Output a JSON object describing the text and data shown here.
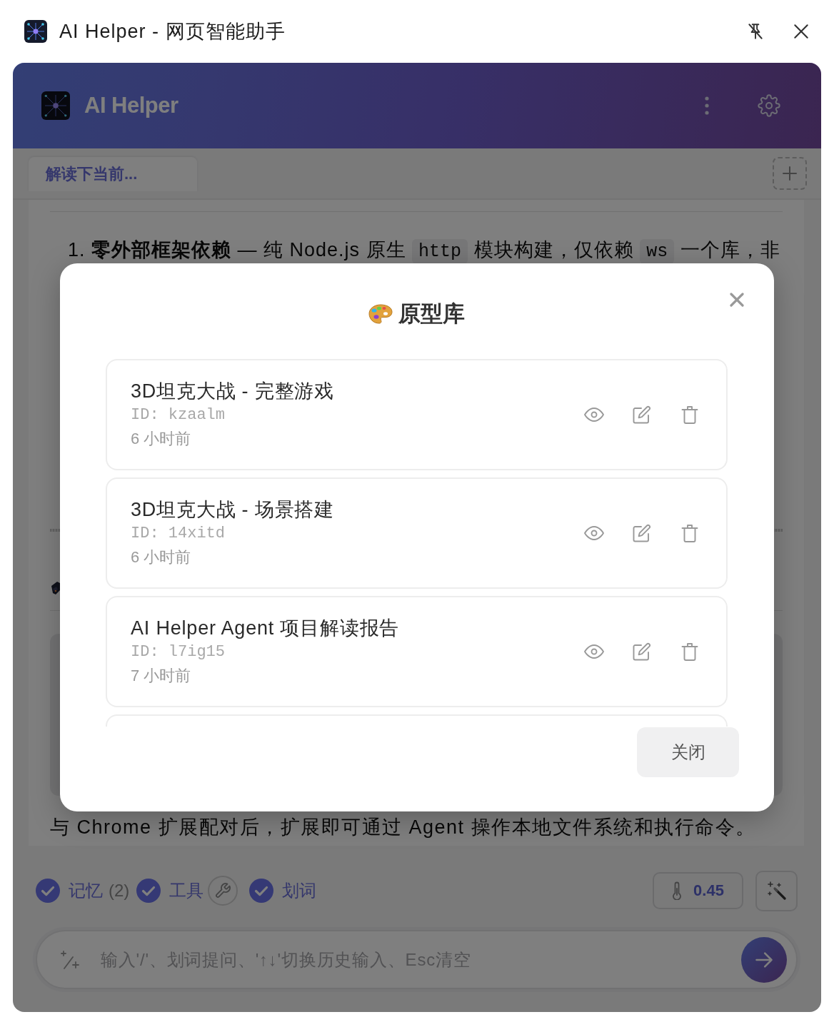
{
  "window": {
    "title": "AI Helper - 网页智能助手"
  },
  "header": {
    "title": "AI Helper"
  },
  "tabs": [
    {
      "label": "解读下当前...",
      "selected": true
    }
  ],
  "message": {
    "list_item": {
      "number": "1.",
      "segments": [
        {
          "kind": "text",
          "text": "**零外部框架依赖** — 纯 Node.js 原生 "
        },
        {
          "kind": "code",
          "text": "http"
        },
        {
          "kind": "text",
          "text": " 模块构建，仅依赖 "
        },
        {
          "kind": "code",
          "text": "ws"
        },
        {
          "kind": "text",
          "text": " 一个库，非"
        }
      ]
    },
    "closing_text": "与 Chrome 扩展配对后，扩展即可通过 Agent 操作本地文件系统和执行命令。"
  },
  "toolbar": {
    "toggles": [
      {
        "label": "记忆",
        "count": "(2)",
        "checked": true,
        "settings": false
      },
      {
        "label": "工具",
        "checked": true,
        "settings": true
      },
      {
        "label": "划词",
        "checked": true,
        "settings": false
      }
    ],
    "temperature": "0.45"
  },
  "input": {
    "placeholder": "输入'/'、划词提问、'↑↓'切换历史输入、Esc清空"
  },
  "modal": {
    "title": "原型库",
    "items": [
      {
        "title": "3D坦克大战 - 完整游戏",
        "id": "ID: kzaalm",
        "time": "6 小时前"
      },
      {
        "title": "3D坦克大战 - 场景搭建",
        "id": "ID: 14xitd",
        "time": "6 小时前"
      },
      {
        "title": "AI Helper Agent 项目解读报告",
        "id": "ID: l7ig15",
        "time": "7 小时前"
      }
    ],
    "more_below": true,
    "close_button": "关闭"
  }
}
